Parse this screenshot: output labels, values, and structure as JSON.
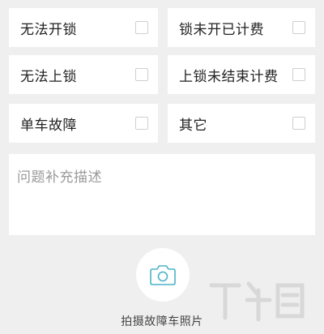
{
  "options": [
    {
      "label": "无法开锁",
      "checked": false
    },
    {
      "label": "锁未开已计费",
      "checked": false
    },
    {
      "label": "无法上锁",
      "checked": false
    },
    {
      "label": "上锁未结束计费",
      "checked": false
    },
    {
      "label": "单车故障",
      "checked": false
    },
    {
      "label": "其它",
      "checked": false
    }
  ],
  "description": {
    "placeholder": "问题补充描述"
  },
  "photo": {
    "label": "拍摄故障车照片",
    "icon": "camera-icon"
  },
  "colors": {
    "background": "#efefef",
    "accent": "#4ab3c8"
  }
}
